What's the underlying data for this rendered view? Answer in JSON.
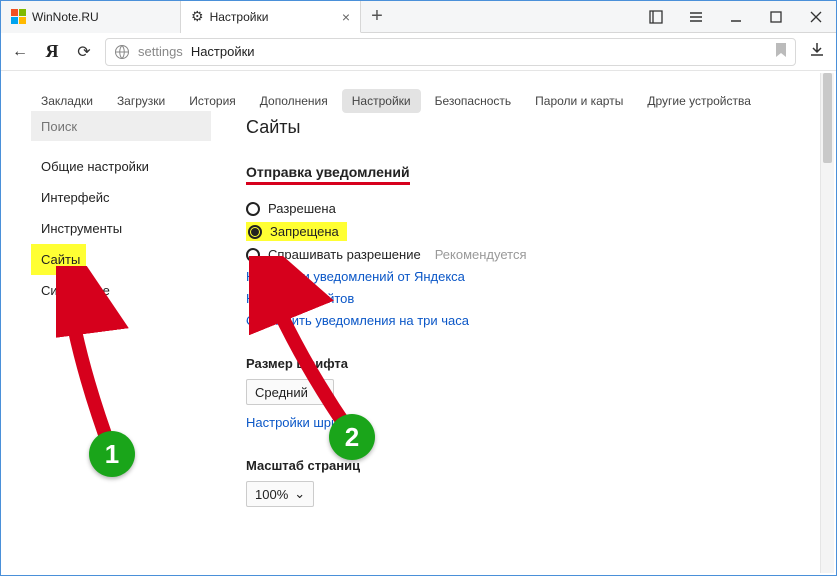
{
  "tabs": [
    {
      "title": "WinNote.RU"
    },
    {
      "title": "Настройки"
    }
  ],
  "address": {
    "scope": "settings",
    "text": "Настройки"
  },
  "section_tabs": [
    "Закладки",
    "Загрузки",
    "История",
    "Дополнения",
    "Настройки",
    "Безопасность",
    "Пароли и карты",
    "Другие устройства"
  ],
  "section_active_index": 4,
  "sidebar": {
    "search_placeholder": "Поиск",
    "items": [
      "Общие настройки",
      "Интерфейс",
      "Инструменты",
      "Сайты",
      "Системные"
    ],
    "active_index": 3
  },
  "content": {
    "heading": "Сайты",
    "notifications": {
      "title": "Отправка уведомлений",
      "options": [
        "Разрешена",
        "Запрещена",
        "Спрашивать разрешение"
      ],
      "selected_index": 1,
      "recommend_label": "Рекомендуется"
    },
    "links": [
      "Настройки уведомлений от Яндекса",
      "Настройки сайтов",
      "Отключить уведомления на три часа"
    ],
    "font_size": {
      "label": "Размер шрифта",
      "value": "Средний",
      "config_link": "Настройки шрифтов"
    },
    "zoom": {
      "label": "Масштаб страниц",
      "value": "100%"
    }
  },
  "annotations": {
    "badge1": "1",
    "badge2": "2"
  }
}
